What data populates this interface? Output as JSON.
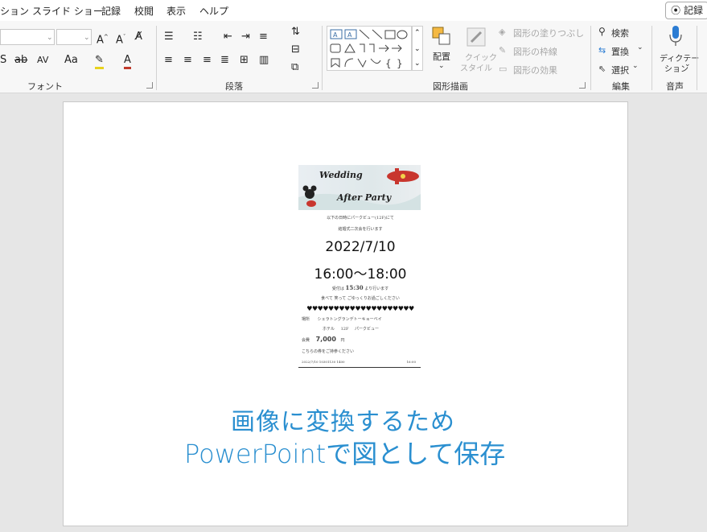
{
  "menubar": {
    "items": [
      "ション",
      "スライド ショー",
      "記録",
      "校閲",
      "表示",
      "ヘルプ"
    ],
    "record_button": "記録"
  },
  "ribbon": {
    "font_group": {
      "label": "フォント"
    },
    "paragraph_group": {
      "label": "段落"
    },
    "drawing_group": {
      "label": "図形描画",
      "arrange": "配置",
      "quick_style": "クイック\nスタイル",
      "quick_style_l1": "クイック",
      "quick_style_l2": "スタイル",
      "shape_fill": "図形の塗りつぶし",
      "shape_outline": "図形の枠線",
      "shape_effects": "図形の効果"
    },
    "editing_group": {
      "label": "編集",
      "find": "検索",
      "replace": "置換",
      "select": "選択"
    },
    "voice_group": {
      "label": "音声",
      "dictate_l1": "ディクテー",
      "dictate_l2": "ション"
    }
  },
  "ticket": {
    "banner_line1": "Wedding",
    "banner_line2": "After Party",
    "intro_line1": "以下の日時にパークビュー(12F)にて",
    "intro_line2": "結婚式二次会を行います",
    "date": "2022/7/10",
    "time": "16:00〜18:00",
    "reception_prefix": "受付は",
    "reception_time": "15:30",
    "reception_suffix": "より行います",
    "enjoy": "食べて 笑って ごゆっくりお過ごしください",
    "hearts": "♥♥♥♥♥♥♥♥♥♥♥♥♥♥♥♥♥♥♥♥",
    "venue_label": "場所",
    "venue_name": "シェラトングランデトーキョーベイ",
    "venue_floor_prefix": "ホテル",
    "venue_floor": "12F",
    "venue_room": "パークビュー",
    "fee_label": "会費",
    "fee_amount": "7,000",
    "fee_unit": "円",
    "bring_ticket": "こちらの券をご持参ください",
    "footer_left": "2022/7/10 10301130 1400",
    "footer_right": "16:00"
  },
  "handwriting": {
    "line1": "画像に変換するため",
    "line2": "PowerPointで図として保存"
  },
  "colors": {
    "handwriting": "#2a8fd0",
    "ribbon_bg": "#f7f7f7",
    "canvas_bg": "#e6e6e6",
    "banner_red": "#c8362e",
    "mic_blue": "#2b7cd3"
  }
}
